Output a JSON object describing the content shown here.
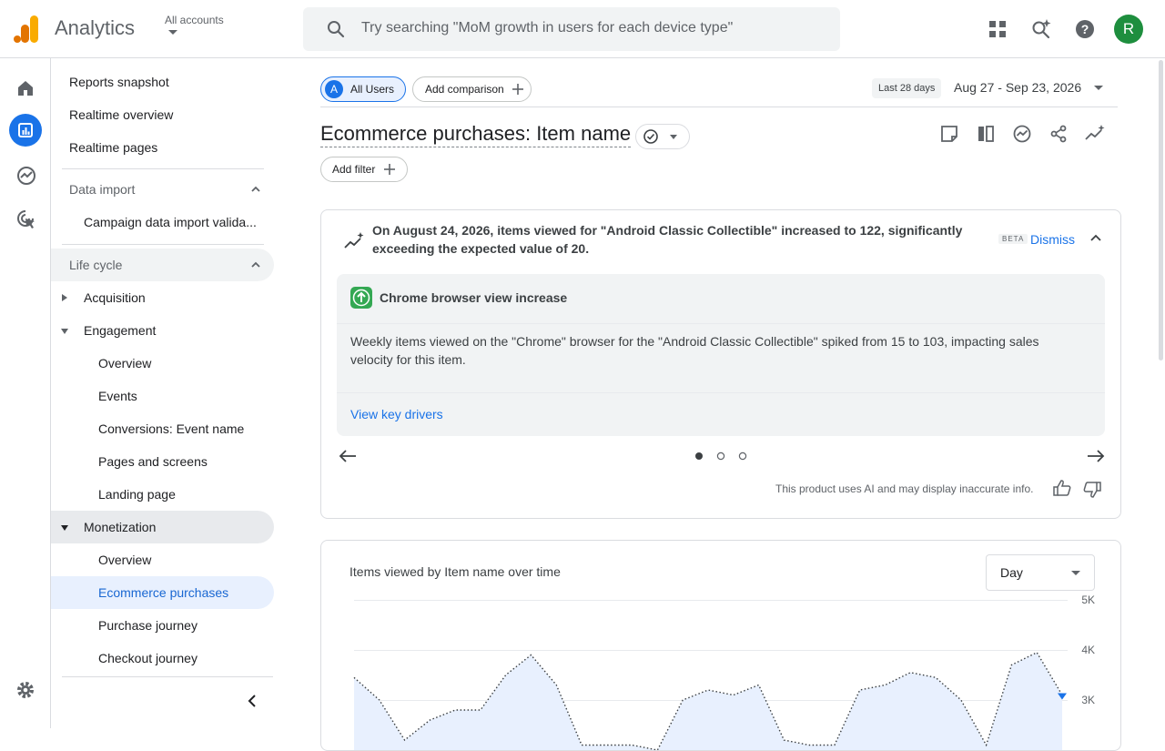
{
  "header": {
    "app_title": "Analytics",
    "account_label": "All accounts",
    "search_placeholder": "Try searching \"MoM growth in users for each device type\"",
    "avatar_initial": "R"
  },
  "nav": {
    "items": [
      {
        "label": "Reports snapshot"
      },
      {
        "label": "Realtime overview"
      },
      {
        "label": "Realtime pages"
      }
    ],
    "data_import": {
      "label": "Data import",
      "child": "Campaign data import valida..."
    },
    "life_cycle": {
      "label": "Life cycle",
      "acquisition": "Acquisition",
      "engagement": {
        "label": "Engagement",
        "children": [
          "Overview",
          "Events",
          "Conversions: Event name",
          "Pages and screens",
          "Landing page"
        ]
      },
      "monetization": {
        "label": "Monetization",
        "children": [
          "Overview",
          "Ecommerce purchases",
          "Purchase journey",
          "Checkout journey"
        ]
      }
    }
  },
  "toolbar": {
    "segment_badge": "A",
    "segment_label": "All Users",
    "add_comparison": "Add comparison",
    "date_range_label": "Last 28 days",
    "date_range": "Aug 27 - Sep 23, 2026",
    "page_title": "Ecommerce purchases: Item name",
    "add_filter": "Add filter"
  },
  "insight": {
    "headline": "On August 24, 2026, items viewed for \"Android Classic Collectible\" increased to 122, significantly exceeding the expected value of 20.",
    "beta": "BETA",
    "dismiss": "Dismiss",
    "sub_title": "Chrome browser view increase",
    "body": "Weekly items viewed on the \"Chrome\" browser for the \"Android Classic Collectible\" spiked from 15 to 103, impacting sales velocity for this item.",
    "link": "View key drivers",
    "disclaimer": "This product uses AI and may display inaccurate info.",
    "pager_total": 3,
    "pager_active": 1
  },
  "chart": {
    "title": "Items viewed by Item name over time",
    "granularity": "Day"
  },
  "chart_data": {
    "type": "area",
    "title": "Items viewed by Item name over time",
    "yticks": [
      "5K",
      "4K",
      "3K"
    ],
    "ylim": [
      2500,
      5000
    ],
    "x": [
      0,
      1,
      2,
      3,
      4,
      5,
      6,
      7,
      8,
      9,
      10,
      11,
      12,
      13,
      14,
      15,
      16,
      17,
      18,
      19,
      20,
      21,
      22,
      23,
      24,
      25,
      26,
      27
    ],
    "values": [
      3450,
      3000,
      2200,
      2600,
      2800,
      2800,
      3500,
      3900,
      3300,
      2100,
      2100,
      2100,
      2000,
      3000,
      3200,
      3100,
      3300,
      2200,
      2100,
      2100,
      3200,
      3300,
      3550,
      3450,
      3000,
      2100,
      3700,
      3950,
      3100
    ],
    "accent": "#1a73e8",
    "fill": "#e8f0fe"
  },
  "colors": {
    "accent": "#1a73e8",
    "active_bg": "#e8f0fe",
    "hover_bg": "#f1f3f4",
    "analytics_orange": "#f9ab00",
    "analytics_dark_orange": "#e37400",
    "insight_green": "#34a853"
  }
}
